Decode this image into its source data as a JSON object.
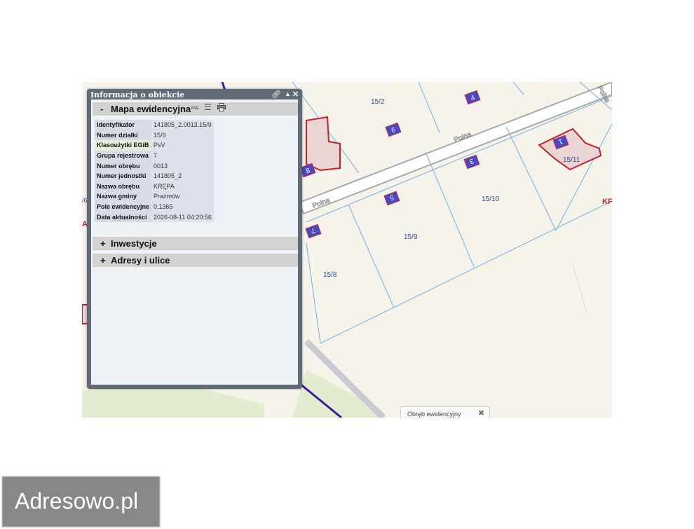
{
  "info_panel": {
    "title": "Informacja o obiekcie",
    "sections": [
      {
        "sign": "-",
        "label": "Mapa ewidencyjna",
        "xml_label": "XML"
      },
      {
        "sign": "+",
        "label": "Inwestycje"
      },
      {
        "sign": "+",
        "label": "Adresy i ulice"
      }
    ],
    "attributes": [
      {
        "key": "Identyfikator",
        "value": "141805_2.0013.15/9"
      },
      {
        "key": "Numer działki",
        "value": "15/9"
      },
      {
        "key": "Klasoużytki EGiB",
        "value": "PsV"
      },
      {
        "key": "Grupa rejestrowa",
        "value": "7"
      },
      {
        "key": "Numer obrębu",
        "value": "0013"
      },
      {
        "key": "Numer jednostki",
        "value": "141805_2"
      },
      {
        "key": "Nazwa obrębu",
        "value": "KRĘPA"
      },
      {
        "key": "Nazwa gminy",
        "value": "Prażmów"
      },
      {
        "key": "Pole ewidencyjne",
        "value": "0.1365"
      },
      {
        "key": "Data aktualności",
        "value": "2026-08-11 04:20:56"
      }
    ]
  },
  "map": {
    "parcel_labels": [
      "15/2",
      "15/10",
      "15/9",
      "15/8",
      "15/11"
    ],
    "street_labels": [
      "Polna",
      "Polna",
      "Polna"
    ],
    "house_numbers": [
      "4",
      "6",
      "3",
      "5",
      "7",
      "8",
      "1"
    ],
    "edge_texts": [
      "KF",
      "A",
      "/6"
    ],
    "colors": {
      "parcel_line": "#6fb0e8",
      "building": "#c8202a",
      "marker": "#4848c8",
      "road": "#a9a9a9"
    }
  },
  "legend": {
    "label": "Obręb ewidencyjny"
  },
  "brand": {
    "name": "Adresowo.pl"
  }
}
